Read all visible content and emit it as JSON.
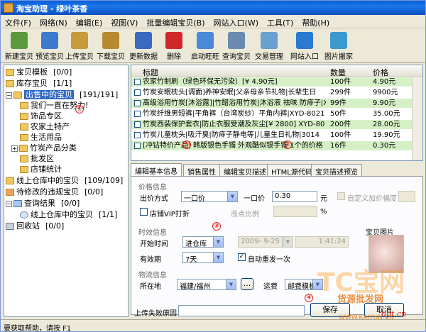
{
  "window": {
    "title": "淘宝助理 - 绿叶茶香"
  },
  "menu": [
    "文件(F)",
    "网络(N)",
    "编辑(E)",
    "视图(V)",
    "批量编辑宝贝(B)",
    "网站入口(W)",
    "工具(T)",
    "帮助(H)"
  ],
  "toolbar": [
    {
      "label": "新建宝贝",
      "icon": "new-item-icon",
      "color": "#5a9a3c"
    },
    {
      "label": "预览宝贝",
      "icon": "preview-icon",
      "color": "#3c7ad0"
    },
    {
      "label": "上传宝贝",
      "icon": "upload-icon",
      "color": "#c89a3a"
    },
    {
      "label": "下载宝贝",
      "icon": "download-icon",
      "color": "#b88a30"
    },
    {
      "label": "更新数据",
      "icon": "update-data-icon",
      "color": "#3a6ac0"
    },
    {
      "label": "删除",
      "icon": "delete-icon",
      "color": "#d02828"
    },
    {
      "label": "启动旺旺",
      "icon": "wangwang-icon",
      "color": "#4a8ad8"
    },
    {
      "label": "查询宝贝",
      "icon": "search-icon",
      "color": "#6a8ab0"
    },
    {
      "label": "交易管理",
      "icon": "trade-icon",
      "color": "#6aa0d0"
    },
    {
      "label": "网站入口",
      "icon": "globe-icon",
      "color": "#2a7ad0"
    },
    {
      "label": "图片搬家",
      "icon": "image-move-icon",
      "color": "#3a9ad0"
    }
  ],
  "annotations": {
    "a1": "①",
    "a2": "②",
    "a3": "③",
    "a4": "④",
    "a5": "⑤",
    "a6": "⑥"
  },
  "tree": [
    {
      "label": "宝贝模板",
      "count": "[0/0]"
    },
    {
      "label": "库存宝贝",
      "count": "[1/1]"
    },
    {
      "label": "出售中的宝贝",
      "count": "[191/191]"
    },
    {
      "label": "我们一直在努力!",
      "count": ""
    },
    {
      "label": "饰品专区",
      "count": ""
    },
    {
      "label": "农家土特产",
      "count": ""
    },
    {
      "label": "生活用品",
      "count": ""
    },
    {
      "label": "竹炭产品分类",
      "count": ""
    },
    {
      "label": "批发区",
      "count": ""
    },
    {
      "label": "店铺统计",
      "count": ""
    },
    {
      "label": "线上仓库中的宝贝",
      "count": "[109/109]"
    },
    {
      "label": "待修改的违规宝贝",
      "count": "[0/0]"
    },
    {
      "label": "查询结果",
      "count": "[0/0]"
    },
    {
      "label": "线上仓库中的宝贝",
      "count": "[1/1]"
    },
    {
      "label": "回收站",
      "count": "[0/0]"
    }
  ],
  "grid": {
    "headers": {
      "title": "标题",
      "qty": "数量",
      "price": "价格"
    },
    "rows": [
      {
        "title": "农家竹制刷（绿色环保无污染）[¥ 4.90元]",
        "qty": "100件",
        "price": "4.90元"
      },
      {
        "title": "竹炭安眠枕头[调面]养神安眠|父亲母亲节礼物|长辈生日",
        "qty": "299件",
        "price": "9900元"
      },
      {
        "title": "高级浴用竹炭[沐浴露]|竹醋浴用竹炭|沐浴液 祛味 防痱子|XYD-",
        "qty": "99件",
        "price": "9.90元"
      },
      {
        "title": "竹炭纤维男短裤|平角裤（台湾炭纱）平角内裤|XYD-8021",
        "qty": "50件",
        "price": "35.00元"
      },
      {
        "title": "竹炭西装保护套衣|防止衣服受潮及灰尘[¥ 2800] XYD-80",
        "qty": "200件",
        "price": "28.00元"
      },
      {
        "title": "竹炭儿童枕头|吸汗臭|防痱子静电等|儿童生日礼物|3014",
        "qty": "100件",
        "price": "19.90元"
      },
      {
        "title": "[冲钻特价产品] 韩版银色手镯 外观酷似银手镯 1个的价格",
        "qty": "16件",
        "price": "0.30元"
      }
    ]
  },
  "tabs": [
    "编辑基本信息",
    "销售属性",
    "编辑宝贝描述",
    "HTML源代码",
    "宝贝描述预览"
  ],
  "form": {
    "price_group": "价格信息",
    "sell_mode_label": "出价方式",
    "sell_mode_value": "一口价",
    "fixed_price_label": "一口价",
    "fixed_price_value": "0.30",
    "price_unit": "元",
    "custom_markup_label": "自定义加价幅度",
    "vip_label": "店铺VIP打折",
    "raise_ratio_label": "涨点比例",
    "percent": "%",
    "time_group": "时效信息",
    "start_label": "开始时间",
    "start_value": "进仓库",
    "date_value": "2009- 9-25",
    "time_value": "1:41:24",
    "validity_label": "有效期",
    "validity_value": "7天",
    "auto_relist_label": "自动重发一次",
    "picture_label": "宝贝图片",
    "logistics_group": "物流信息",
    "location_label": "所在地",
    "location_value": "福建/福州",
    "ellipsis": "...",
    "freight_label": "运费",
    "freight_value": "邮费模板",
    "upload_fail_label": "上传失败原因",
    "save": "保存",
    "cancel": "取消"
  },
  "status": "要获取帮助，请按 F1",
  "watermark": {
    "w1": "TC宝网",
    "w2": "货源批发网",
    "w3": "6pt.cn",
    "w4": "WWW.KAIYUN.CN"
  }
}
